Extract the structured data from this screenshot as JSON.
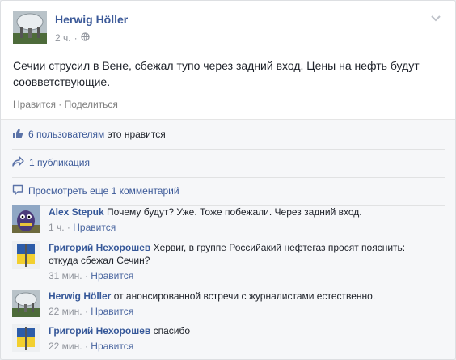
{
  "post": {
    "author": "Herwig Höller",
    "time": "2 ч.",
    "text": "Сечии струсил в Вене, сбежал тупо через задний вход. Цены на нефть будут соовветствующие.",
    "like_action": "Нравится",
    "share_action": "Поделиться",
    "dot": "·"
  },
  "ufi": {
    "likes_link": "6 пользователям",
    "likes_rest": " это нравится",
    "shares": "1 публикация",
    "view_more": "Просмотреть еще 1 комментарий"
  },
  "comments": [
    {
      "author": "Alex Stepuk",
      "text": " Почему будут? Уже. Тоже побежали. Через задний вход.",
      "time": "1 ч.",
      "like": "Нравится"
    },
    {
      "author": "Григорий Нехорошев",
      "text": " Хервиг, в группе Российакий нефтегаз просят пояснить: откуда сбежал Сечин?",
      "time": "31 мин.",
      "like": "Нравится"
    },
    {
      "author": "Herwig Höller",
      "text": " от анонсированной встречи с журналистами естественно.",
      "time": "22 мин.",
      "like": "Нравится"
    },
    {
      "author": "Григорий Нехорошев",
      "text": " спасибо",
      "time": "22 мин.",
      "like": "Нравится"
    }
  ],
  "icons": {
    "privacy": "globe-icon",
    "options": "chevron-down-icon",
    "like": "thumbs-up-icon",
    "share": "share-arrow-icon",
    "comments": "comment-bubble-icon"
  },
  "colors": {
    "link": "#3b5998",
    "muted": "#90949c",
    "ufi_bg": "#f6f7f9"
  }
}
